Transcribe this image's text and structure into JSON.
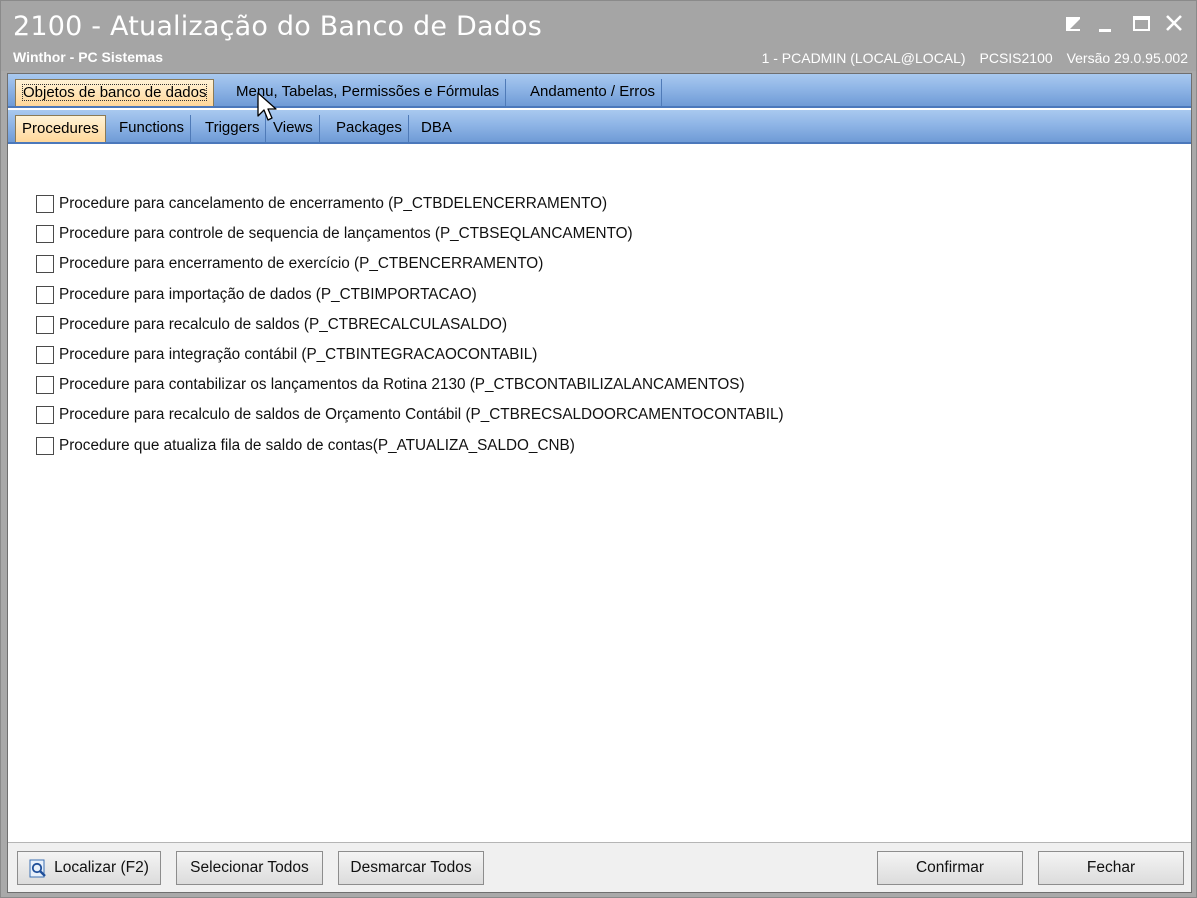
{
  "window": {
    "title": "2100 - Atualização do Banco de Dados",
    "subtitle": "Winthor - PC Sistemas",
    "status": {
      "user": "1 - PCADMIN (LOCAL@LOCAL)",
      "module": "PCSIS2100",
      "version": "Versão  29.0.95.002"
    }
  },
  "tabs_main": [
    {
      "label": "Objetos de banco de dados",
      "active": true
    },
    {
      "label": "Menu, Tabelas, Permissões e Fórmulas",
      "active": false
    },
    {
      "label": "Andamento / Erros",
      "active": false
    }
  ],
  "tabs_sub": [
    {
      "label": "Procedures",
      "active": true
    },
    {
      "label": "Functions",
      "active": false
    },
    {
      "label": "Triggers",
      "active": false
    },
    {
      "label": "Views",
      "active": false
    },
    {
      "label": "Packages",
      "active": false
    },
    {
      "label": "DBA",
      "active": false
    }
  ],
  "procedures": [
    {
      "label": "Procedure para cancelamento de encerramento (P_CTBDELENCERRAMENTO)",
      "checked": false
    },
    {
      "label": "Procedure para controle de sequencia de lançamentos (P_CTBSEQLANCAMENTO)",
      "checked": false
    },
    {
      "label": "Procedure para encerramento de exercício (P_CTBENCERRAMENTO)",
      "checked": false
    },
    {
      "label": "Procedure para importação de dados (P_CTBIMPORTACAO)",
      "checked": false
    },
    {
      "label": "Procedure para recalculo de saldos (P_CTBRECALCULASALDO)",
      "checked": false
    },
    {
      "label": "Procedure para integração contábil (P_CTBINTEGRACAOCONTABIL)",
      "checked": false
    },
    {
      "label": "Procedure para contabilizar os lançamentos da Rotina 2130 (P_CTBCONTABILIZALANCAMENTOS)",
      "checked": false
    },
    {
      "label": "Procedure para recalculo de saldos de Orçamento Contábil (P_CTBRECSALDOORCAMENTOCONTABIL)",
      "checked": false
    },
    {
      "label": "Procedure que atualiza fila de saldo de contas(P_ATUALIZA_SALDO_CNB)",
      "checked": false
    }
  ],
  "buttons": {
    "localizar": "Localizar (F2)",
    "selecionar_todos": "Selecionar Todos",
    "desmarcar_todos": "Desmarcar Todos",
    "confirmar": "Confirmar",
    "fechar": "Fechar"
  },
  "colors": {
    "tab_bar": "#8fb5e6",
    "active_tab": "#ffd79a",
    "titlebar": "#a5a5a5"
  }
}
